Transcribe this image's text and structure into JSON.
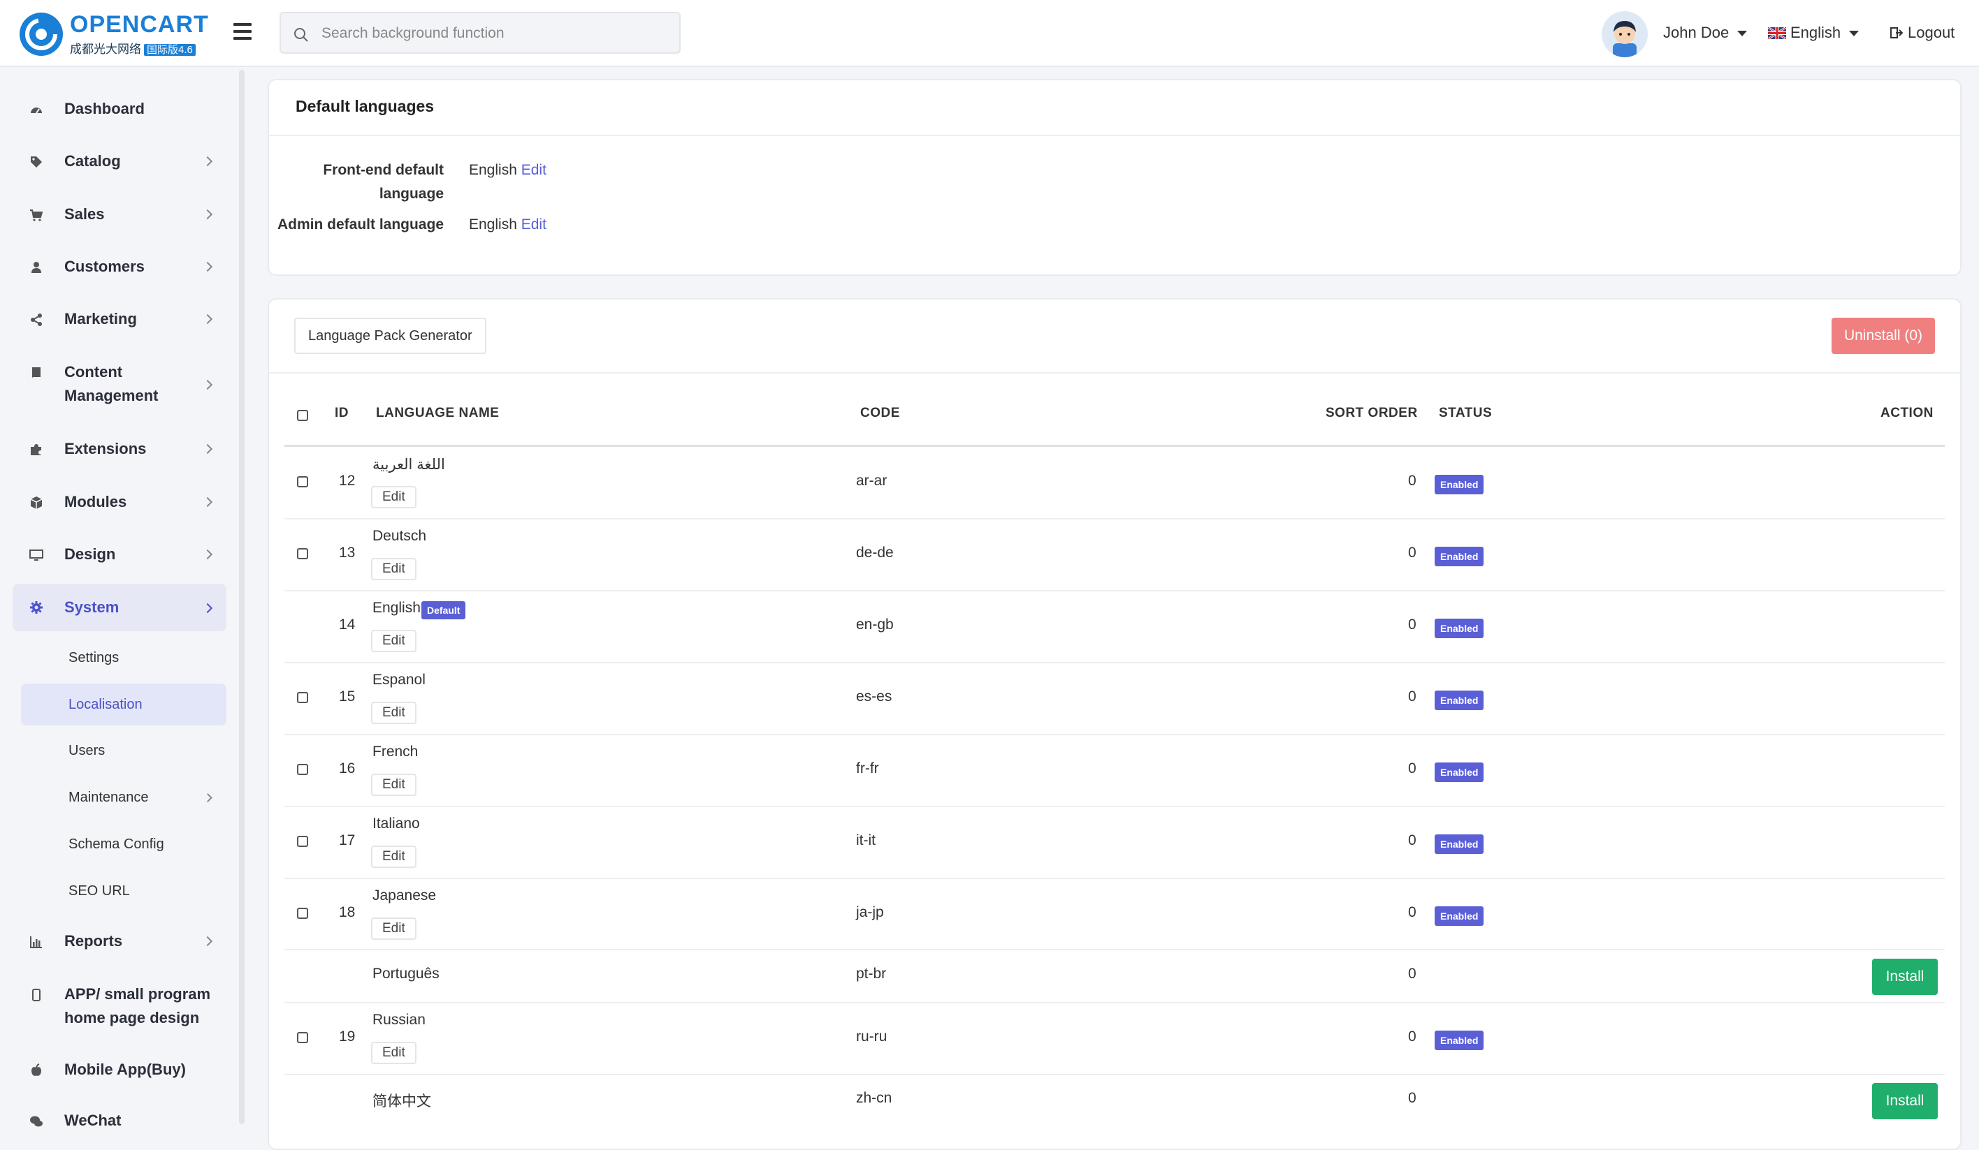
{
  "header": {
    "logo_text": "OPENCART",
    "logo_sub": "成都光大网络",
    "logo_badge": "国际版4.6",
    "search_placeholder": "Search background function",
    "user_name": "John Doe",
    "language": "English",
    "logout": "Logout"
  },
  "sidebar": {
    "dashboard": "Dashboard",
    "catalog": "Catalog",
    "sales": "Sales",
    "customers": "Customers",
    "marketing": "Marketing",
    "content": "Content Management",
    "extensions": "Extensions",
    "modules": "Modules",
    "design": "Design",
    "system": "System",
    "sub": {
      "settings": "Settings",
      "localisation": "Localisation",
      "users": "Users",
      "maintenance": "Maintenance",
      "schema": "Schema Config",
      "seo": "SEO URL"
    },
    "reports": "Reports",
    "app": "APP/ small program home page design",
    "mobile": "Mobile App(Buy)",
    "wechat": "WeChat"
  },
  "defaults": {
    "title": "Default languages",
    "frontend_label": "Front-end default language",
    "frontend_value": "English",
    "admin_label": "Admin default language",
    "admin_value": "English",
    "edit": "Edit"
  },
  "list": {
    "generator_button": "Language Pack Generator",
    "uninstall_button": "Uninstall (0)",
    "headers": {
      "id": "ID",
      "name": "LANGUAGE NAME",
      "code": "CODE",
      "sort": "SORT ORDER",
      "status": "STATUS",
      "action": "ACTION"
    },
    "edit_label": "Edit",
    "default_badge": "Default",
    "status_label": "Enabled",
    "install_label": "Install",
    "rows": [
      {
        "id": "12",
        "name": "اللغة العربية",
        "code": "ar-ar",
        "sort": "0"
      },
      {
        "id": "13",
        "name": "Deutsch",
        "code": "de-de",
        "sort": "0"
      },
      {
        "id": "14",
        "name": "English",
        "code": "en-gb",
        "sort": "0"
      },
      {
        "id": "15",
        "name": "Espanol",
        "code": "es-es",
        "sort": "0"
      },
      {
        "id": "16",
        "name": "French",
        "code": "fr-fr",
        "sort": "0"
      },
      {
        "id": "17",
        "name": "Italiano",
        "code": "it-it",
        "sort": "0"
      },
      {
        "id": "18",
        "name": "Japanese",
        "code": "ja-jp",
        "sort": "0"
      },
      {
        "id": "",
        "name": "Português",
        "code": "pt-br",
        "sort": "0"
      },
      {
        "id": "19",
        "name": "Russian",
        "code": "ru-ru",
        "sort": "0"
      },
      {
        "id": "",
        "name": "简体中文",
        "code": "zh-cn",
        "sort": "0"
      }
    ]
  }
}
